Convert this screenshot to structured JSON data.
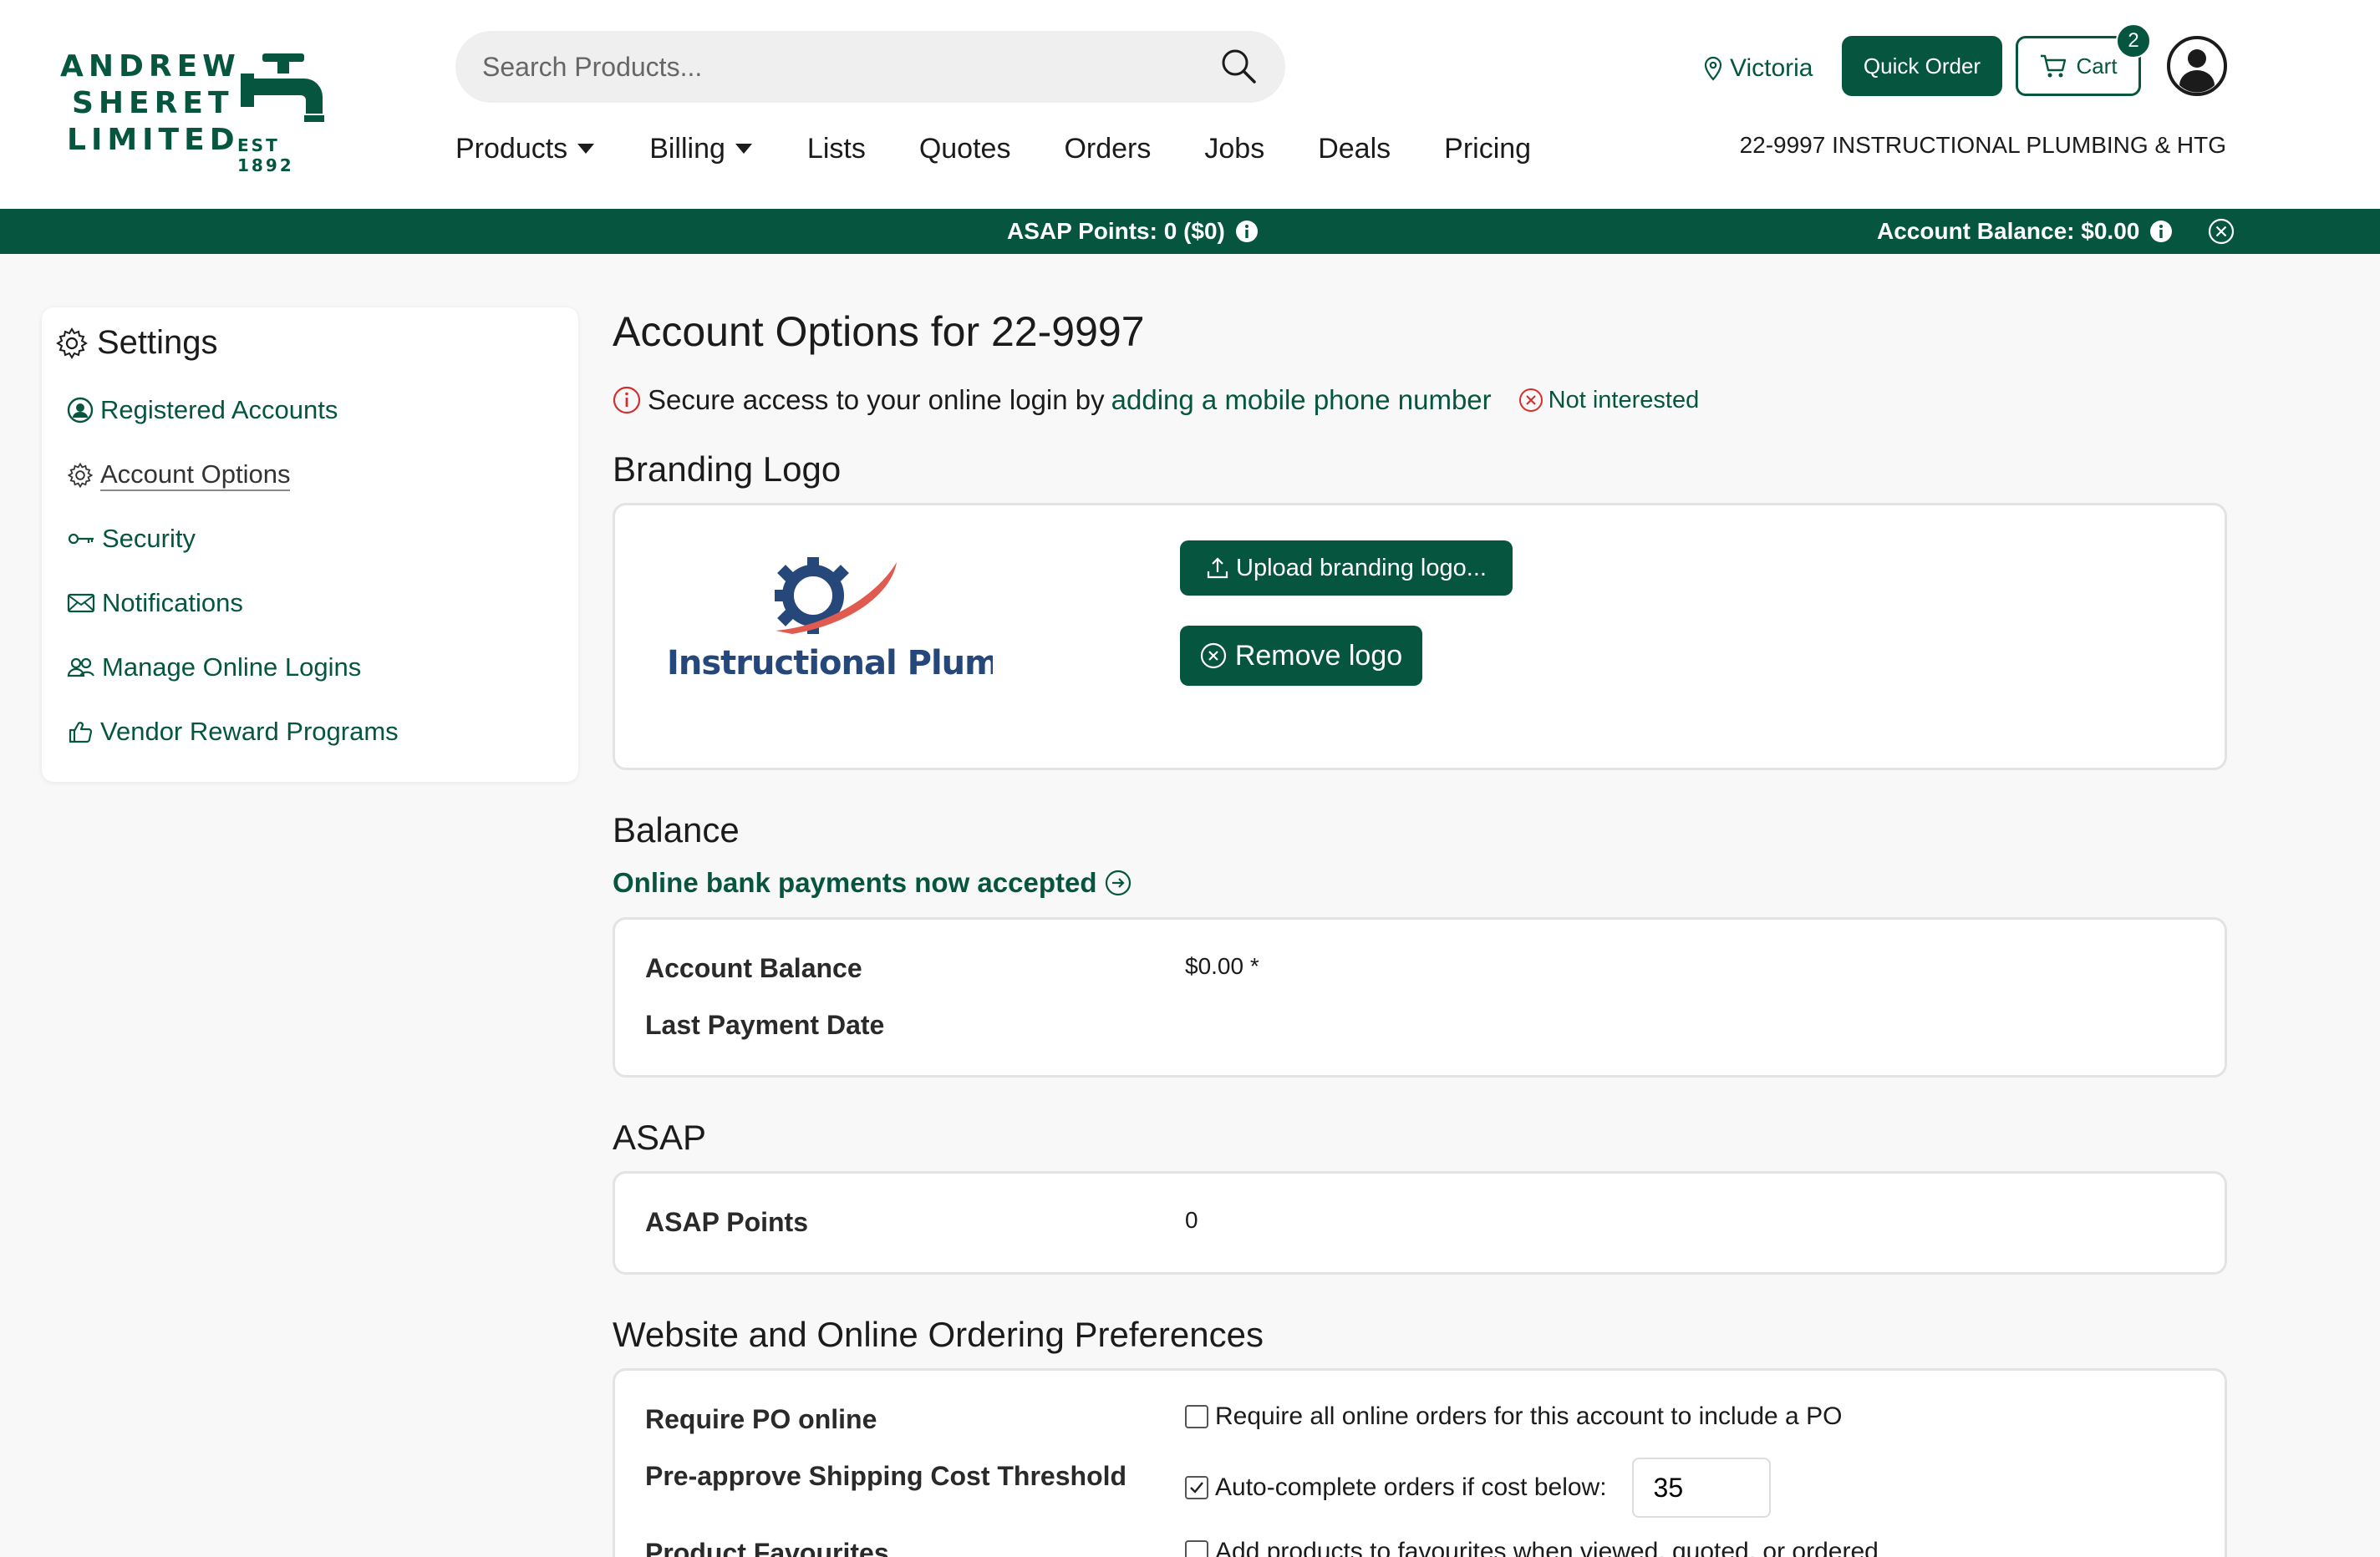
{
  "brand": {
    "line1": "ANDREW",
    "line2": "SHERET",
    "line3": "LIMITED",
    "est": "EST 1892",
    "color": "#06563f"
  },
  "search": {
    "placeholder": "Search Products..."
  },
  "header": {
    "location": "Victoria",
    "quick_order": "Quick Order",
    "cart_label": "Cart",
    "cart_count": "2",
    "account_name": "22-9997 INSTRUCTIONAL PLUMBING & HTG"
  },
  "nav": [
    {
      "label": "Products",
      "dropdown": true
    },
    {
      "label": "Billing",
      "dropdown": true
    },
    {
      "label": "Lists"
    },
    {
      "label": "Quotes"
    },
    {
      "label": "Orders"
    },
    {
      "label": "Jobs"
    },
    {
      "label": "Deals"
    },
    {
      "label": "Pricing"
    }
  ],
  "banner": {
    "asap_points": "ASAP Points: 0 ($0)",
    "account_balance": "Account Balance: $0.00"
  },
  "sidebar": {
    "title": "Settings",
    "items": [
      {
        "label": "Registered Accounts",
        "icon": "user-circle-icon"
      },
      {
        "label": "Account Options",
        "icon": "gear-icon",
        "active": true
      },
      {
        "label": "Security",
        "icon": "key-icon"
      },
      {
        "label": "Notifications",
        "icon": "envelope-icon"
      },
      {
        "label": "Manage Online Logins",
        "icon": "people-icon"
      },
      {
        "label": "Vendor Reward Programs",
        "icon": "thumbs-up-icon"
      }
    ]
  },
  "main": {
    "title": "Account Options for 22-9997",
    "alert": {
      "prefix": "Secure access to your online login by",
      "link": "adding a mobile phone number",
      "dismiss": "Not interested"
    },
    "branding": {
      "title": "Branding Logo",
      "logo_text": "Instructional Plumbing",
      "upload": "Upload branding logo...",
      "remove": "Remove logo"
    },
    "balance": {
      "title": "Balance",
      "promo": "Online bank payments now accepted",
      "account_balance_label": "Account Balance",
      "account_balance_value": "$0.00 *",
      "last_payment_label": "Last Payment Date",
      "last_payment_value": ""
    },
    "asap": {
      "title": "ASAP",
      "points_label": "ASAP Points",
      "points_value": "0"
    },
    "prefs": {
      "title": "Website and Online Ordering Preferences",
      "po_label": "Require PO online",
      "po_text": "Require all online orders for this account to include a PO",
      "po_checked": false,
      "ship_label": "Pre-approve Shipping Cost Threshold",
      "ship_text": "Auto-complete orders if cost below:",
      "ship_checked": true,
      "ship_value": "35",
      "fav_label": "Product Favourites",
      "fav_text": "Add products to favourites when viewed, quoted, or ordered",
      "fav_checked": false
    }
  }
}
